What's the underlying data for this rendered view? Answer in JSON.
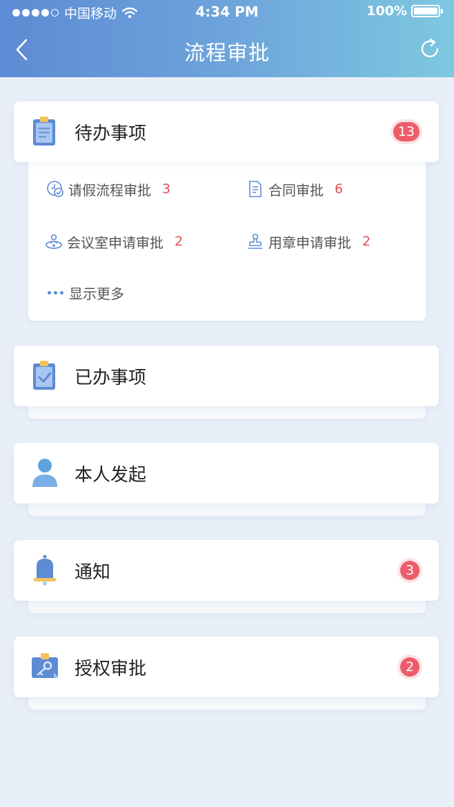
{
  "status_bar": {
    "carrier": "中国移动",
    "time": "4:34 PM",
    "battery": "100%"
  },
  "nav": {
    "title": "流程审批",
    "back_icon": "back-arrow-icon",
    "refresh_icon": "refresh-icon"
  },
  "colors": {
    "accent": "#5d8bd4",
    "badge": "#ec5c6a",
    "count": "#e94c55",
    "background": "#e8eff8"
  },
  "pending": {
    "label": "待办事项",
    "badge": "13",
    "icon": "clipboard-icon",
    "items": [
      {
        "label": "请假流程审批",
        "count": "3",
        "icon": "clock-check-icon"
      },
      {
        "label": "合同审批",
        "count": "6",
        "icon": "document-icon"
      },
      {
        "label": "会议室申请审批",
        "count": "2",
        "icon": "meeting-people-icon"
      },
      {
        "label": "用章申请审批",
        "count": "2",
        "icon": "stamp-icon"
      }
    ],
    "more_label": "显示更多"
  },
  "done": {
    "label": "已办事项",
    "icon": "clipboard-check-icon"
  },
  "mine": {
    "label": "本人发起",
    "icon": "person-icon"
  },
  "notice": {
    "label": "通知",
    "badge": "3",
    "icon": "bell-icon"
  },
  "auth": {
    "label": "授权审批",
    "badge": "2",
    "icon": "key-card-icon"
  }
}
